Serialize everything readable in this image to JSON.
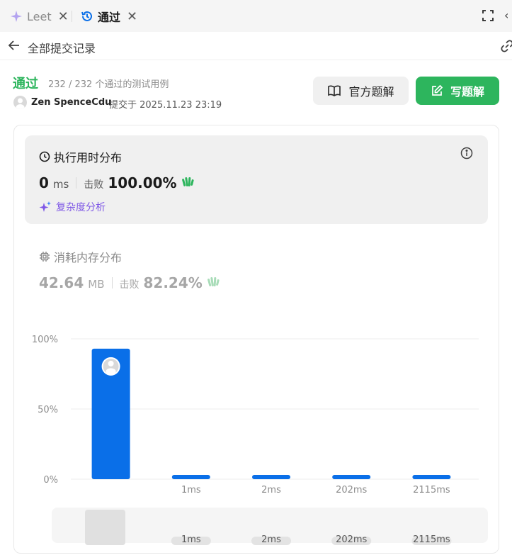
{
  "tabs": [
    {
      "label": "Leet",
      "icon": "sparkle-icon",
      "active": false
    },
    {
      "label": "通过",
      "icon": "history-icon",
      "active": true
    }
  ],
  "nav": {
    "title": "全部提交记录"
  },
  "submission": {
    "status": "通过",
    "cases": "232 / 232 个通过的测试用例",
    "user": "Zen SpenceCdu",
    "submitted_at": "提交于 2025.11.23 23:19"
  },
  "buttons": {
    "official": "官方题解",
    "write": "写题解"
  },
  "runtime": {
    "title": "执行用时分布",
    "value": "0",
    "unit": "ms",
    "beat_label": "击败",
    "beat_value": "100.00%",
    "complexity": "复杂度分析"
  },
  "memory": {
    "title": "消耗内存分布",
    "value": "42.64",
    "unit": "MB",
    "beat_label": "击败",
    "beat_value": "82.24%"
  },
  "colors": {
    "accent_green": "#2db55d",
    "bar_blue": "#0a6fe8",
    "purple": "#7e57e6"
  },
  "chart_data": {
    "type": "bar",
    "categories": [
      "",
      "1ms",
      "2ms",
      "202ms",
      "2115ms"
    ],
    "values": [
      93,
      1,
      1,
      1,
      1
    ],
    "ylim": [
      0,
      100
    ],
    "yticks": [
      "100%",
      "50%",
      "0%"
    ],
    "grid": true,
    "range_labels": [
      "1ms",
      "2ms",
      "202ms",
      "2115ms"
    ]
  }
}
